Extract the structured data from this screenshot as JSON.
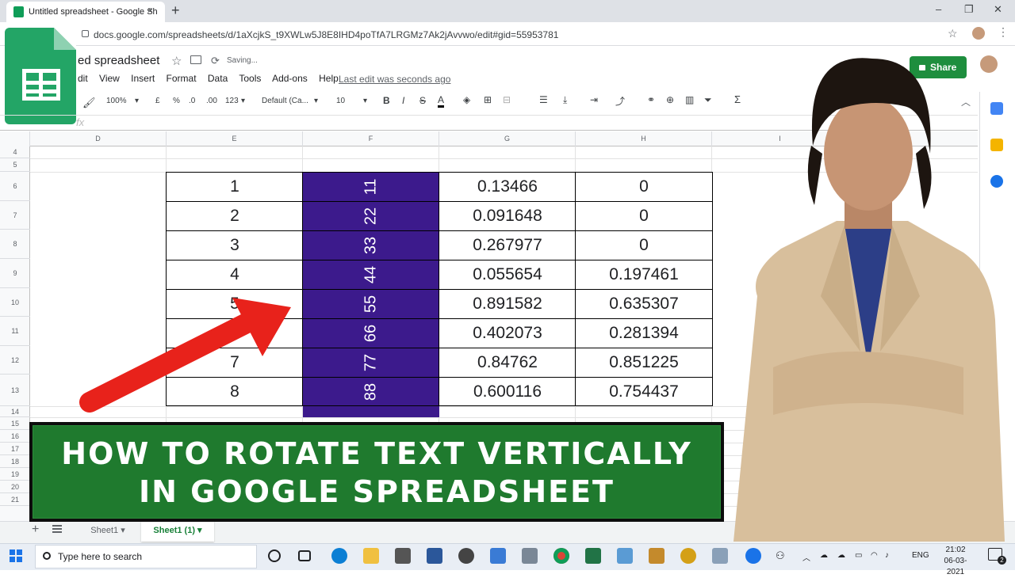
{
  "browser": {
    "tab_title": "Untitled spreadsheet - Google Sh",
    "tab_close": "×",
    "new_tab": "+",
    "url": "docs.google.com/spreadsheets/d/1aXcjkS_t9XWLw5J8E8IHD4poTfA7LRGMz7Ak2jAvvwo/edit#gid=55953781",
    "window_controls": [
      "–",
      "❐",
      "✕"
    ]
  },
  "sheets": {
    "doc_title": "ed spreadsheet",
    "saving": "Saving...",
    "menu": [
      "dit",
      "View",
      "Insert",
      "Format",
      "Data",
      "Tools",
      "Add-ons",
      "Help"
    ],
    "last_edit": "Last edit was seconds ago",
    "share_label": "Share",
    "toolbar": {
      "zoom": "100%",
      "currency": "£",
      "percent": "%",
      "dec_less": ".0",
      "dec_more": ".00",
      "format_more": "123",
      "font": "Default (Ca...",
      "font_size": "10"
    },
    "fx": "fx",
    "columns": [
      "D",
      "E",
      "F",
      "G",
      "H",
      "I"
    ],
    "rows": [
      "4",
      "5",
      "6",
      "7",
      "8",
      "9",
      "10",
      "11",
      "12",
      "13",
      "14",
      "15",
      "16",
      "17",
      "18",
      "19",
      "20",
      "21"
    ],
    "table": {
      "col_e": [
        "1",
        "2",
        "3",
        "4",
        "5",
        "",
        "7",
        "8"
      ],
      "col_f": [
        "11",
        "22",
        "33",
        "44",
        "55",
        "66",
        "77",
        "88"
      ],
      "col_g": [
        "0.13466",
        "0.091648",
        "0.267977",
        "0.055654",
        "0.891582",
        "0.402073",
        "0.84762",
        "0.600116"
      ],
      "col_h": [
        "0",
        "0",
        "0",
        "0.197461",
        "0.635307",
        "0.281394",
        "0.851225",
        "0.754437"
      ]
    },
    "sheet_tabs": [
      "Sheet1",
      "Sheet1 (1)"
    ]
  },
  "banner": {
    "line1": "HOW TO ROTATE TEXT VERTICALLY",
    "line2": "IN GOOGLE SPREADSHEET"
  },
  "taskbar": {
    "search_placeholder": "Type here to search",
    "lang": "ENG",
    "time": "21:02",
    "date": "06-03-2021",
    "notif_count": "2"
  },
  "colors": {
    "accent_green": "#1e8e3e",
    "rotated_column": "#3c1a8c",
    "banner_green": "#1f7a2e",
    "arrow_red": "#e8221b"
  }
}
